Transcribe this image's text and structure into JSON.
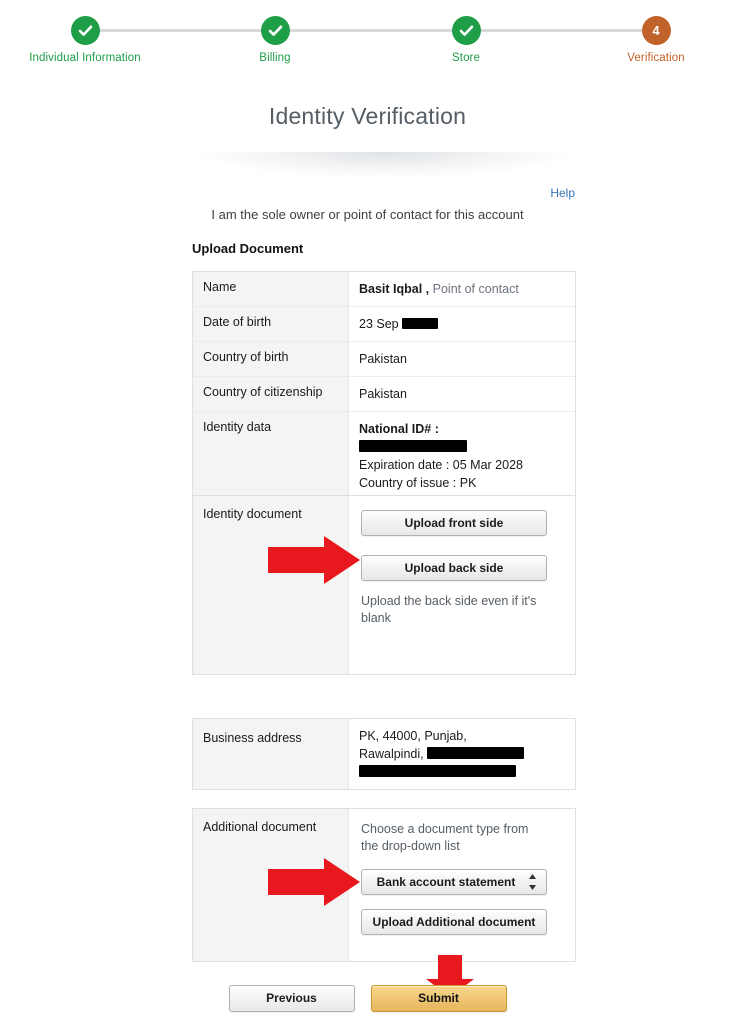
{
  "stepper": {
    "steps": [
      {
        "label": "Individual Information",
        "state": "done",
        "marker": "check-icon"
      },
      {
        "label": "Billing",
        "state": "done",
        "marker": "check-icon"
      },
      {
        "label": "Store",
        "state": "done",
        "marker": "check-icon"
      },
      {
        "label": "Verification",
        "state": "current",
        "marker": "4"
      }
    ],
    "done_color": "#1e9e47",
    "current_color": "#c1622a",
    "track_color": "#d8d8d8"
  },
  "header": {
    "title": "Identity Verification",
    "help_label": "Help",
    "help_color": "#3b75b5",
    "subtitle": "I am the sole owner or point of contact for this account"
  },
  "section": {
    "upload_document_heading": "Upload Document"
  },
  "info_table": {
    "rows": [
      {
        "label": "Name",
        "value": "Basit Iqbal ,",
        "value_muted": "Point of contact"
      },
      {
        "label": "Date of birth",
        "value": "23 Sep",
        "redacted": true
      },
      {
        "label": "Country of birth",
        "value": "Pakistan"
      },
      {
        "label": "Country of citizenship",
        "value": "Pakistan"
      }
    ],
    "identity_data": {
      "label": "Identity data",
      "national_id_label": "National ID# :",
      "national_id_value_redacted": true,
      "expiration": "Expiration date : 05 Mar 2028",
      "country_of_issue": "Country of issue : PK"
    }
  },
  "identity_document": {
    "label": "Identity document",
    "upload_front_label": "Upload front side",
    "upload_back_label": "Upload back side",
    "hint": "Upload the back side even if it's blank"
  },
  "business_address": {
    "label": "Business address",
    "line1": "PK, 44000, Punjab,",
    "line2_prefix": "Rawalpindi,",
    "line2_redacted": true,
    "line3_redacted": true
  },
  "additional_document": {
    "label": "Additional document",
    "hint": "Choose a document type from the drop-down list",
    "selected_option": "Bank account statement",
    "options": [
      "Bank account statement"
    ],
    "upload_label": "Upload Additional document",
    "select_icon": "updown-chevron-icon"
  },
  "footer": {
    "previous_label": "Previous",
    "submit_label": "Submit",
    "submit_color": "#f0c878"
  },
  "annotations": {
    "arrow_color": "#e8191e",
    "arrows": [
      {
        "name": "arrow-identity-document",
        "direction": "right"
      },
      {
        "name": "arrow-additional-document",
        "direction": "right"
      },
      {
        "name": "arrow-submit",
        "direction": "down"
      }
    ]
  }
}
